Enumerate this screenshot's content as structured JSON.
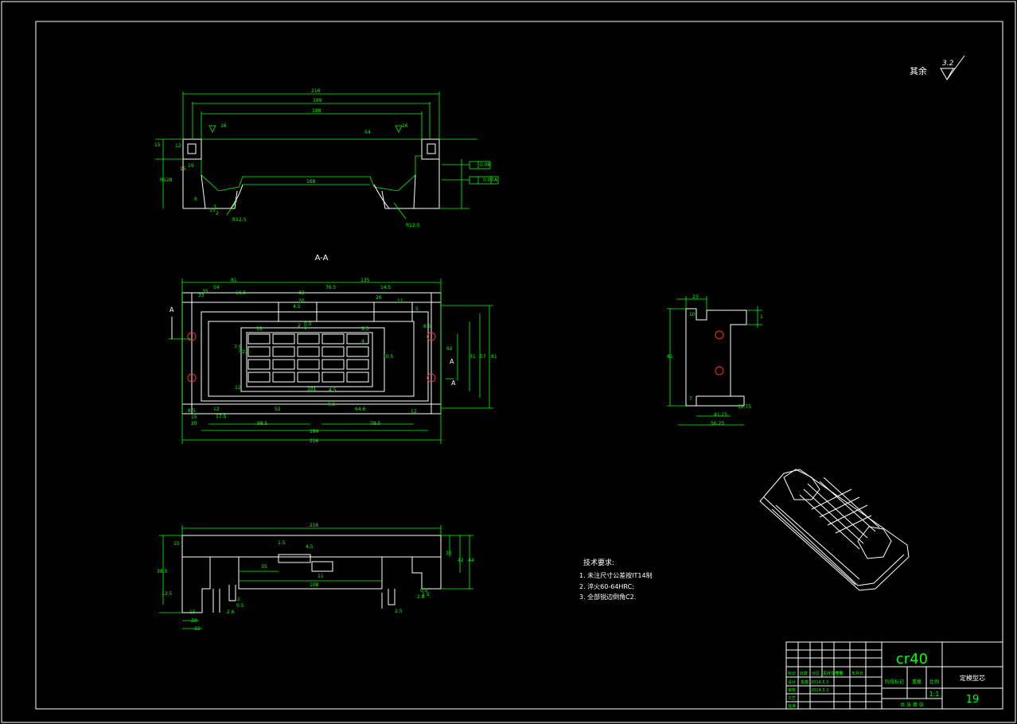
{
  "surface_finish": {
    "label": "其余",
    "value": "3.2"
  },
  "section_label": "A-A",
  "view_marks": [
    "A",
    "A",
    "A"
  ],
  "tech_requirements": {
    "title": "技术要求:",
    "items": [
      "1. 未注尺寸公差按IT14制",
      "2. 淬火60-64HRC;",
      "3. 全部锐边倒角C2."
    ]
  },
  "title_block": {
    "material": "cr40",
    "part_name": "定模型芯",
    "drawing_no": "19",
    "scale": "1:1",
    "headers": [
      "标记",
      "处数",
      "分区",
      "更改文件号",
      "签名",
      "年月日"
    ],
    "rows": [
      "设计",
      "审核",
      "工艺",
      "批准"
    ],
    "stage_label": "阶段标记",
    "weight_label": "重量",
    "scale_label": "比例",
    "sheet_label": "共 张 第 张",
    "dates": [
      "2014.5.3",
      "2014.5.3"
    ],
    "designer": "金鑫"
  },
  "dimensions": {
    "top_view": [
      "216",
      "199",
      "188",
      "16",
      "16",
      "15",
      "12",
      "15",
      "19",
      "R128",
      "6",
      "15",
      "3",
      "2",
      "168",
      "R12.5",
      "R12.5",
      "0.06",
      "0.03",
      "A",
      "54"
    ],
    "mid_view": [
      "81",
      "135",
      "54",
      "76.5",
      "14.5",
      "35",
      "33",
      "16.5",
      "32",
      "20",
      "18",
      "11",
      "4.5",
      "5",
      "26",
      "7.5",
      "9.5",
      "2",
      "1",
      "0.5",
      "4",
      "4.5",
      "8.5",
      "10.5",
      "101",
      "9.5",
      "52",
      "64.6",
      "12",
      "12",
      "17.5",
      "15",
      "20",
      "98.5",
      "78.5",
      "184",
      "216",
      "8.5",
      "92",
      "31",
      "57",
      "81",
      "52.5",
      "12"
    ],
    "bottom_view": [
      "216",
      "1.5",
      "4.5",
      "35",
      "11",
      "108",
      "15",
      "30",
      "42",
      "44",
      "38.5",
      "12.5",
      "20",
      "15",
      "22",
      "2.6",
      "0.5",
      "2",
      "0.5",
      "1.5",
      "2.6",
      "2.5"
    ],
    "side_view": [
      "23",
      "10",
      "81",
      "7",
      "41.25",
      "56.25",
      "12.75",
      "1"
    ]
  }
}
